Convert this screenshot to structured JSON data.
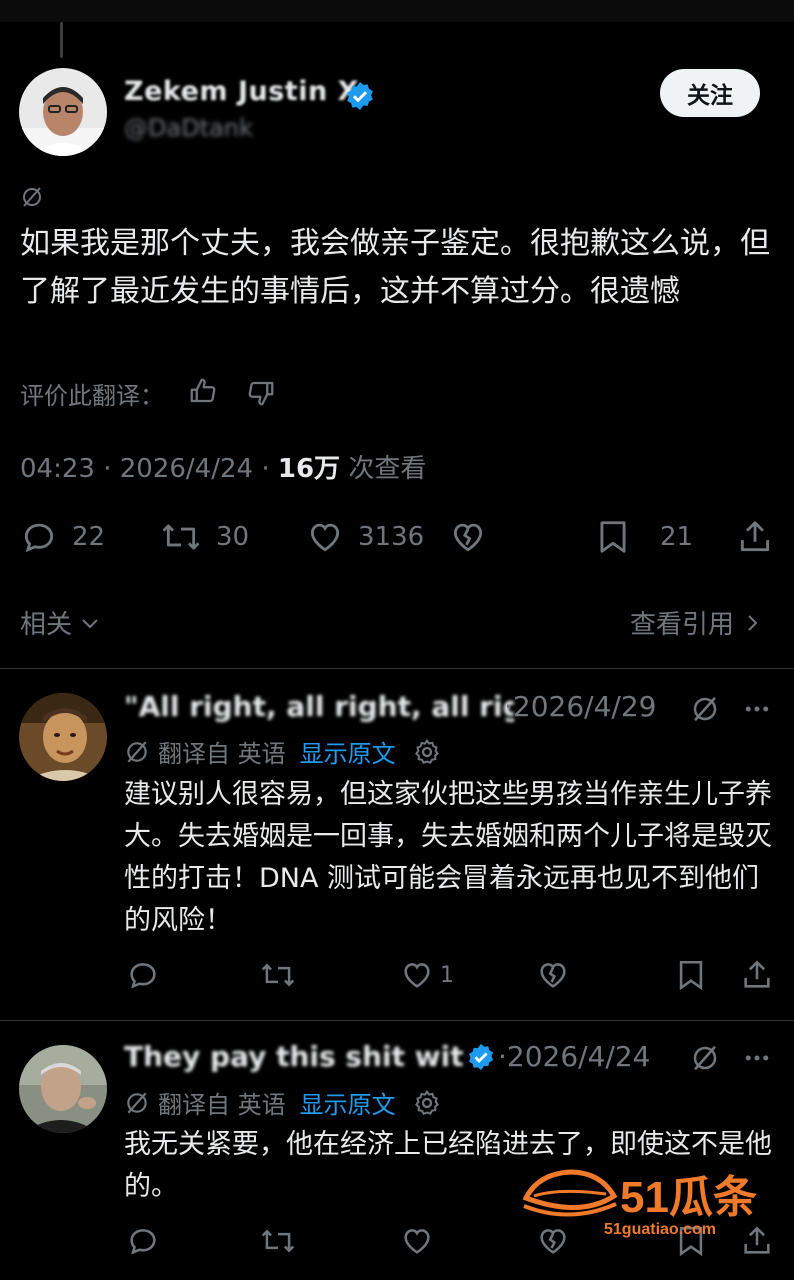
{
  "tweet": {
    "author_name": "Zekem Justin X",
    "author_handle": "@DaDtank",
    "follow_label": "关注",
    "text": "如果我是那个丈夫，我会做亲子鉴定。很抱歉这么说，但了解了最近发生的事情后，这并不算过分。很遗憾",
    "rate_translation": "评价此翻译：",
    "time": "04:23",
    "date": "2026/4/24",
    "views": "16万",
    "views_label": "次查看",
    "replies": "22",
    "retweets": "30",
    "likes": "3136",
    "bookmarks": "21",
    "related_label": "相关",
    "view_quotes_label": "查看引用"
  },
  "replies": [
    {
      "name": "\"All right, all right, all right\"...",
      "date": "2026/4/29",
      "translated_from": "翻译自 英语",
      "show_original": "显示原文",
      "text": "建议别人很容易，但这家伙把这些男孩当作亲生儿子养大。失去婚姻是一回事，失去婚姻和两个儿子将是毁灭性的打击！DNA 测试可能会冒着永远再也见不到他们的风险！",
      "likes": "1"
    },
    {
      "name": "They pay this shit with...",
      "date": "2026/4/24",
      "translated_from": "翻译自 英语",
      "show_original": "显示原文",
      "text": "我无关紧要，他在经济上已经陷进去了，即使这不是他的。"
    }
  ],
  "watermark": {
    "brand": "51瓜条",
    "url": "51guatiao.com"
  },
  "colors": {
    "background": "#000000",
    "text": "#e7e9ea",
    "muted": "#71767b",
    "link": "#1d9bf0",
    "verified": "#1d9bf0",
    "watermark": "#f07a2a"
  }
}
